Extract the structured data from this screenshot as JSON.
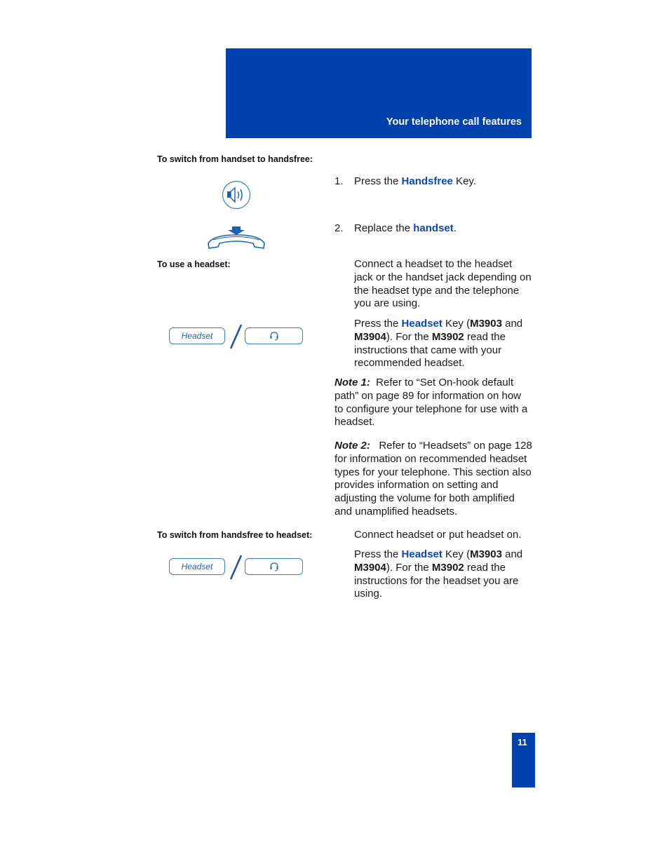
{
  "header": {
    "title": "Your telephone call features"
  },
  "sections": {
    "handset_to_handsfree": {
      "label": "To switch from handset to handsfree:",
      "step1": {
        "num": "1.",
        "pre": "Press the ",
        "key": "Handsfree",
        "post": " Key."
      },
      "step2": {
        "num": "2.",
        "pre": "Replace the ",
        "key": "handset",
        "post": "."
      }
    },
    "use_headset": {
      "label": "To use a headset:",
      "para1": "Connect a headset to the headset jack or the handset jack depending on the headset type and the telephone you are using.",
      "para2": {
        "pre": "Press the ",
        "key": "Headset",
        "mid1": " Key (",
        "m1": "M3903",
        "mid2": " and ",
        "m2": "M3904",
        "mid3": "). For the ",
        "m3": "M3902",
        "post": " read the instructions that came with your recommended headset."
      },
      "note1": {
        "label": "Note 1:",
        "text": "  Refer to “Set On-hook default path” on page 89 for information on how to configure your telephone for use with a headset."
      },
      "note2": {
        "label": "Note 2:",
        "text": "   Refer to “Headsets” on page 128 for information on recommended headset types for your telephone. This section also provides information on setting and adjusting the volume for both amplified and unamplified headsets."
      },
      "key_label": "Headset"
    },
    "handsfree_to_headset": {
      "label": "To switch from handsfree to headset:",
      "para1": "Connect headset or put headset on.",
      "para2": {
        "pre": "Press the ",
        "key": "Headset",
        "mid1": " Key (",
        "m1": "M3903",
        "mid2": " and ",
        "m2": "M3904",
        "mid3": "). For the ",
        "m3": "M3902",
        "post": " read the instructions for the headset you are using."
      },
      "key_label": "Headset"
    }
  },
  "page_number": "11",
  "colors": {
    "brand_blue": "#0041ad",
    "key_blue": "#0a4ab0"
  }
}
